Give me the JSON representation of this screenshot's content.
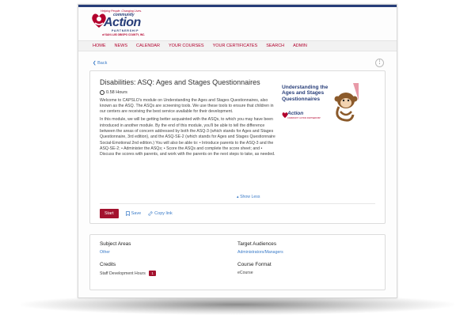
{
  "branding": {
    "tagline": "Helping People. Changing Lives.",
    "logo_line1": "community",
    "logo_line2": "Action",
    "logo_line3": "PARTNERSHIP",
    "logo_line4": "of SAN LUIS OBISPO COUNTY, INC."
  },
  "nav": {
    "items": [
      "HOME",
      "NEWS",
      "CALENDAR",
      "YOUR COURSES",
      "YOUR CERTIFICATES",
      "SEARCH",
      "ADMIN"
    ]
  },
  "back_label": "Back",
  "course": {
    "title": "Disabilities: ASQ: Ages and Stages Questionnaires",
    "hours": "0.58 Hours",
    "paragraph1": "Welcome to CAPSLO's module on Understanding the Ages and Stages Questionnaires, also known as the ASQ. The ASQs are screening tools. We use these tools to ensure that children in our centers are receiving the best service available for their development.",
    "paragraph2": "In this module, we will be getting better acquainted with the ASQs, to which you may have been introduced in another module. By the end of this module, you'll be able to tell the difference between the areas of concern addressed by both the ASQ-3 (which stands for Ages and Stages Questionnaire, 3rd edition), and the ASQ-SE-2 (which stands for Ages and Stages Questionnaire Social-Emotional 2nd edition.) You will also be able to: • Introduce parents to the ASQ-3 and the ASQ-SE-2; • Administer the ASQs; • Score the ASQs and complete the score sheet; and • Discuss the scores with parents, and work with the parents on the next steps to take, as needed.",
    "show_less": "Show Less",
    "thumbnail_text": "Understanding the Ages and Stages Questionnaires",
    "thumbnail_logo_word": "Action",
    "thumbnail_logo_sub": "COMMUNITY ACTION PARTNERSHIP"
  },
  "actions": {
    "start": "Start",
    "save": "Save",
    "copy_link": "Copy link"
  },
  "details": {
    "subject_areas_label": "Subject Areas",
    "subject_areas_value": "Other",
    "target_audiences_label": "Target Audiences",
    "target_audiences_value": "Administrators/Managers",
    "credits_label": "Credits",
    "credits_value": "Staff Development Hours",
    "credits_count": "1",
    "course_format_label": "Course Format",
    "course_format_value": "eCourse"
  },
  "colors": {
    "brand_red": "#a3122e",
    "brand_navy": "#283e79",
    "link_blue": "#3a7bc8"
  },
  "icons": [
    "heart-logo-icon",
    "clock-icon",
    "bookmark-icon",
    "link-icon",
    "kebab-icon",
    "chevron-left-icon",
    "chevron-up-icon"
  ]
}
